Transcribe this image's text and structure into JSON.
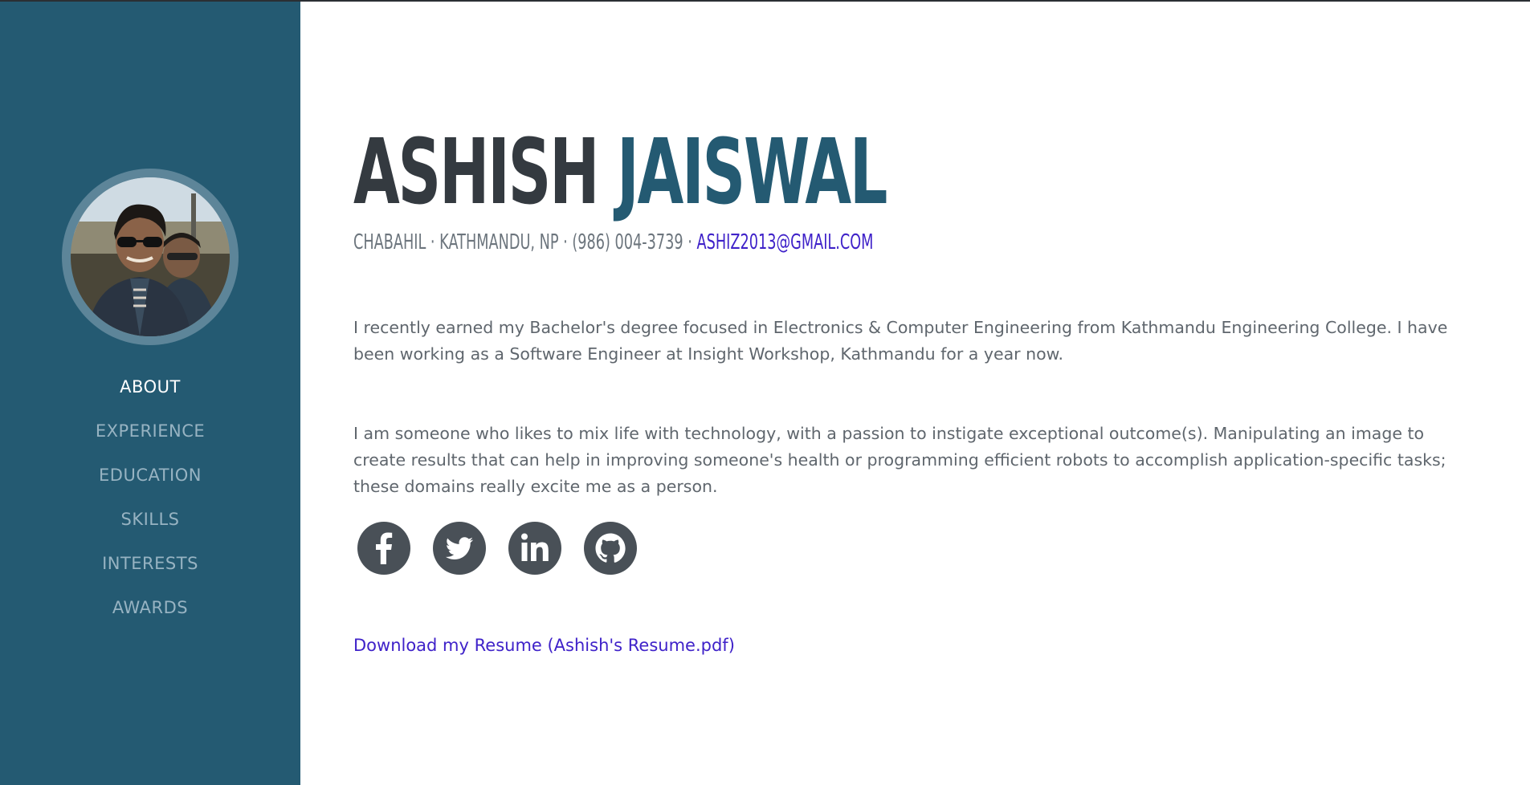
{
  "profile": {
    "first_name": "ASHISH",
    "last_name": "JAISWAL",
    "location": "CHABAHIL · KATHMANDU, NP · (986) 004-3739 ·",
    "email": "ASHIZ2013@GMAIL.COM",
    "photo_icon": "profile-photo"
  },
  "nav": {
    "items": [
      {
        "label": "ABOUT",
        "active": true
      },
      {
        "label": "EXPERIENCE",
        "active": false
      },
      {
        "label": "EDUCATION",
        "active": false
      },
      {
        "label": "SKILLS",
        "active": false
      },
      {
        "label": "INTERESTS",
        "active": false
      },
      {
        "label": "AWARDS",
        "active": false
      }
    ]
  },
  "about": {
    "paragraph1": "I recently earned my Bachelor's degree focused in Electronics & Computer Engineering from Kathmandu Engineering College. I have been working as a Software Engineer at Insight Workshop, Kathmandu for a year now.",
    "paragraph2": "I am someone who likes to mix life with technology, with a passion to instigate exceptional outcome(s). Manipulating an image to create results that can help in improving someone's health or programming efficient robots to accomplish application-specific tasks; these domains really excite me as a person.",
    "resume_link": "Download my Resume (Ashish's Resume.pdf)"
  },
  "social": {
    "icons": [
      "facebook-icon",
      "twitter-icon",
      "linkedin-icon",
      "github-icon"
    ]
  },
  "colors": {
    "sidebar": "#245a72",
    "accent": "#245a72",
    "link": "#3f22c9",
    "text": "#5f666d",
    "heading": "#343a40",
    "icon_bg": "#495057"
  }
}
